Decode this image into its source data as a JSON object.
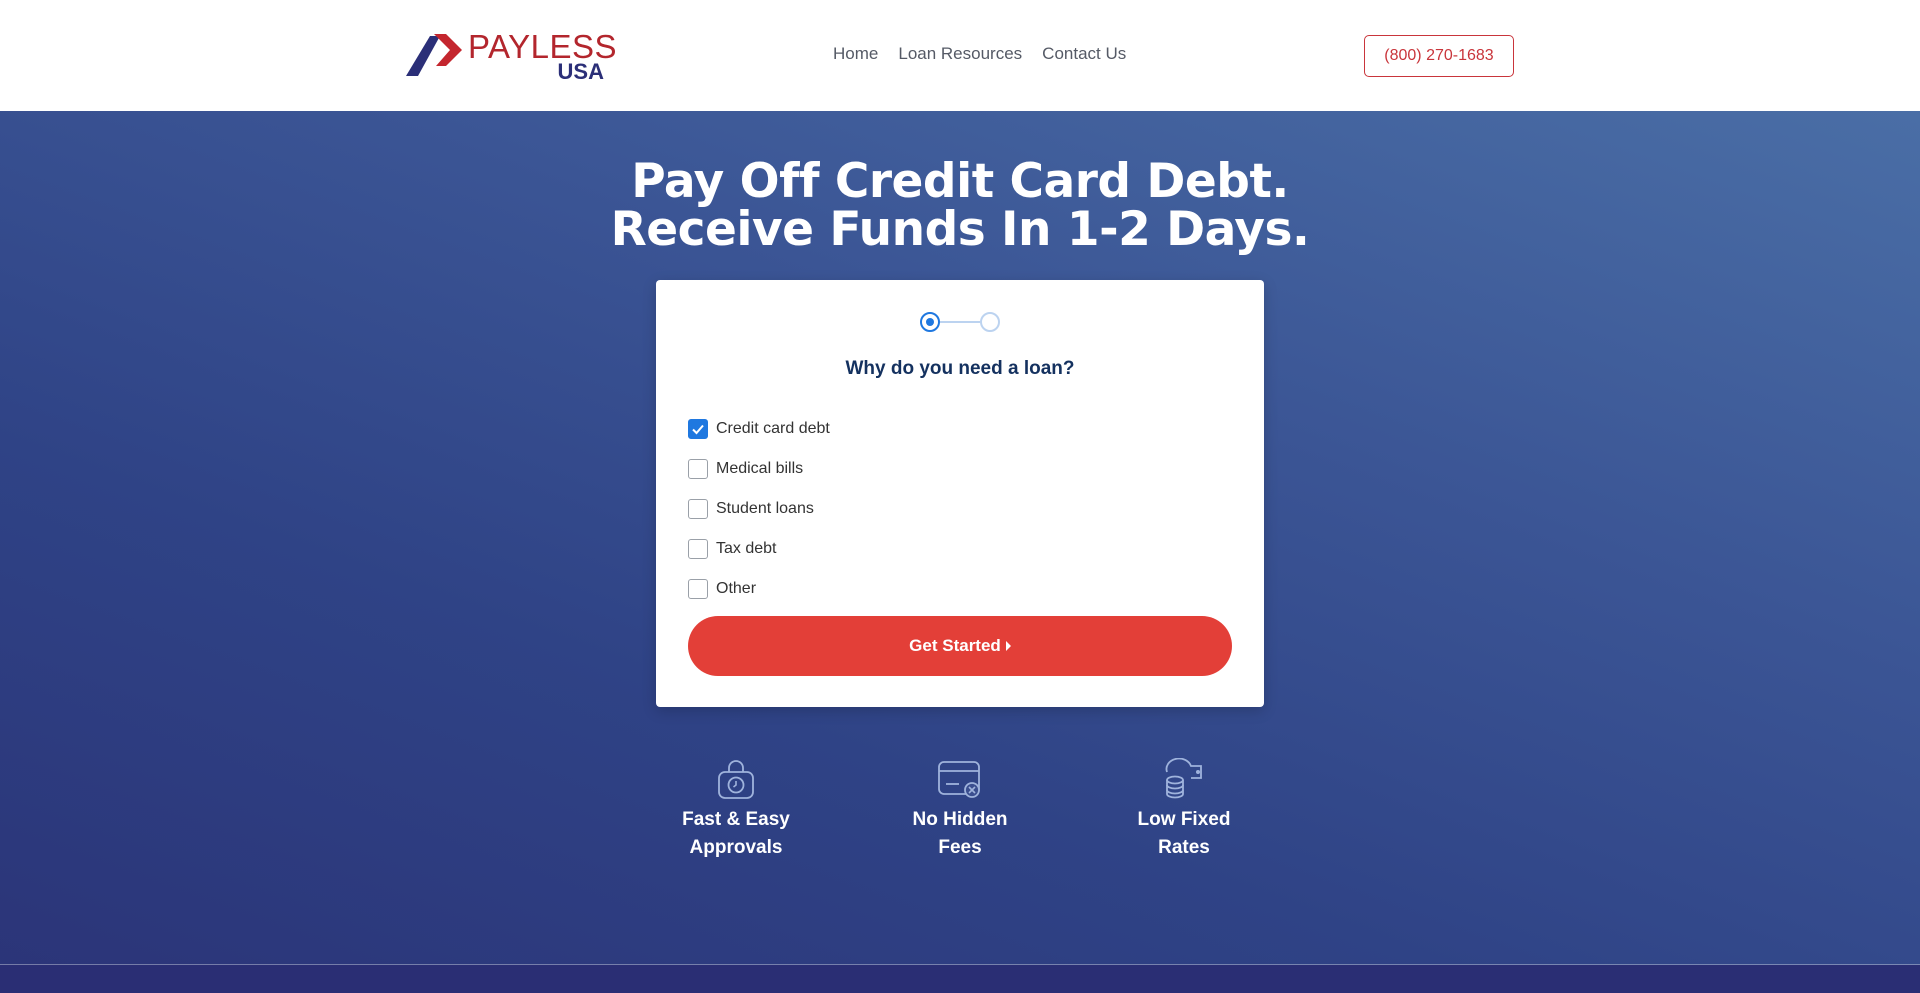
{
  "header": {
    "logo": {
      "word1": "PAYLESS",
      "word2": "USA"
    },
    "nav": [
      {
        "label": "Home"
      },
      {
        "label": "Loan Resources"
      },
      {
        "label": "Contact Us"
      }
    ],
    "phone": "(800) 270-1683"
  },
  "hero": {
    "title_line1": "Pay Off Credit Card Debt.",
    "title_line2": "Receive Funds In 1-2 Days."
  },
  "form": {
    "step_current": 1,
    "step_total": 2,
    "question": "Why do you need a loan?",
    "options": [
      {
        "label": "Credit card debt",
        "checked": true
      },
      {
        "label": "Medical bills",
        "checked": false
      },
      {
        "label": "Student loans",
        "checked": false
      },
      {
        "label": "Tax debt",
        "checked": false
      },
      {
        "label": "Other",
        "checked": false
      }
    ],
    "cta_label": "Get Started"
  },
  "features": [
    {
      "icon": "lock-clock-icon",
      "line1": "Fast & Easy",
      "line2": "Approvals"
    },
    {
      "icon": "card-no-fee-icon",
      "line1": "No Hidden",
      "line2": "Fees"
    },
    {
      "icon": "coins-wallet-icon",
      "line1": "Low Fixed",
      "line2": "Rates"
    }
  ],
  "colors": {
    "brand_red": "#e33f38",
    "brand_navy": "#2b2f78",
    "accent_blue": "#1f78e0",
    "heading_navy": "#14315f"
  }
}
